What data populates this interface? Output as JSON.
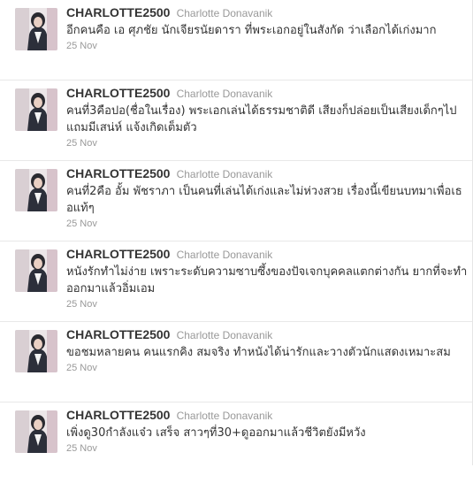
{
  "tweets": [
    {
      "screen_name": "CHARLOTTE2500",
      "full_name": "Charlotte Donavanik",
      "text": "อีกคนคือ เอ ศุภชัย นักเจียรนัยดารา ที่พระเอกอยู่ในสังกัด ว่าเลือกได้เก่งมาก",
      "timestamp": "25 Nov"
    },
    {
      "screen_name": "CHARLOTTE2500",
      "full_name": "Charlotte Donavanik",
      "text": "คนที่3คือปอ(ชื่อในเรื่อง) พระเอกเล่นได้ธรรมชาติดี เสียงก็ปล่อยเป็นเสียงเด็กๆไป แถมมีเสน่ห์ แจ้งเกิดเต็มตัว",
      "timestamp": "25 Nov"
    },
    {
      "screen_name": "CHARLOTTE2500",
      "full_name": "Charlotte Donavanik",
      "text": "คนที่2คือ อั้ม พัชราภา เป็นคนที่เล่นได้เก่งและไม่ห่วงสวย เรื่องนี้เขียนบทมาเพื่อเธอแท้ๆ",
      "timestamp": "25 Nov"
    },
    {
      "screen_name": "CHARLOTTE2500",
      "full_name": "Charlotte Donavanik",
      "text": "หนังรักทำไม่ง่าย เพราะระดับความซาบซึ้งของปัจเจกบุคคลแตกต่างกัน ยากที่จะทำออกมาแล้วอิ่มเอม",
      "timestamp": "25 Nov"
    },
    {
      "screen_name": "CHARLOTTE2500",
      "full_name": "Charlotte Donavanik",
      "text": "ขอชมหลายคน คนแรกคิง สมจริง ทำหนังได้น่ารักและวางตัวนักแสดงเหมาะสม",
      "timestamp": "25 Nov"
    },
    {
      "screen_name": "CHARLOTTE2500",
      "full_name": "Charlotte Donavanik",
      "text": "เพิ่งดู30กำลังแจ๋ว เสร็จ สาวๆที่30+ดูออกมาแล้วชีวิตยังมีหวัง",
      "timestamp": "25 Nov"
    }
  ],
  "icons": {
    "avatar": "profile-photo"
  }
}
